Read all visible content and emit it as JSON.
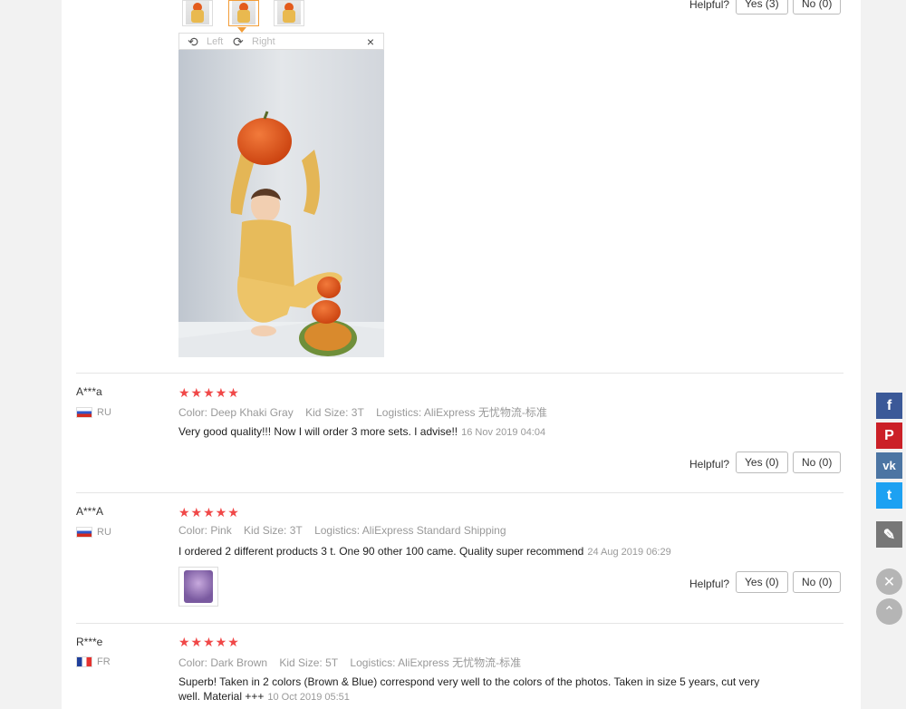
{
  "top_review": {
    "helpful_label": "Helpful?",
    "yes_label": "Yes (3)",
    "no_label": "No (0)"
  },
  "viewer": {
    "rotate_left_icon": "rotate-left-icon",
    "rotate_left_label": "Left",
    "rotate_right_icon": "rotate-right-icon",
    "rotate_right_label": "Right",
    "close_glyph": "×"
  },
  "reviews": [
    {
      "user": "A***a",
      "country": "RU",
      "stars": "★★★★★",
      "color": "Color: Deep Khaki Gray",
      "size": "Kid Size: 3T",
      "logistics": "Logistics: AliExpress 无忧物流-标准",
      "text": "Very good quality!!! Now I will order 3 more sets. I advise!!",
      "date": "16 Nov 2019 04:04",
      "helpful_label": "Helpful?",
      "yes_label": "Yes (0)",
      "no_label": "No (0)"
    },
    {
      "user": "A***A",
      "country": "RU",
      "stars": "★★★★★",
      "color": "Color: Pink",
      "size": "Kid Size: 3T",
      "logistics": "Logistics: AliExpress Standard Shipping",
      "text": "I ordered 2 different products 3 t. One 90 other 100 came. Quality super recommend",
      "date": "24 Aug 2019 06:29",
      "helpful_label": "Helpful?",
      "yes_label": "Yes (0)",
      "no_label": "No (0)"
    },
    {
      "user": "R***e",
      "country": "FR",
      "stars": "★★★★★",
      "color": "Color: Dark Brown",
      "size": "Kid Size: 5T",
      "logistics": "Logistics: AliExpress 无忧物流-标准",
      "text": "Superb! Taken in 2 colors (Brown & Blue) correspond very well to the colors of the photos. Taken in size 5 years, cut very well. Material +++",
      "date": "10 Oct 2019 05:51"
    }
  ],
  "social": {
    "facebook": "f",
    "pinterest": "P",
    "vk": "vk",
    "twitter": "t",
    "edit_icon": "pencil-icon",
    "close_icon": "close-icon",
    "top_icon": "chevron-up-icon"
  },
  "colors": {
    "star": "#f04848",
    "facebook": "#3b5998",
    "pinterest": "#cb2027",
    "vk": "#4c75a3",
    "twitter": "#1da1f2",
    "active_thumb": "#f29d38"
  }
}
